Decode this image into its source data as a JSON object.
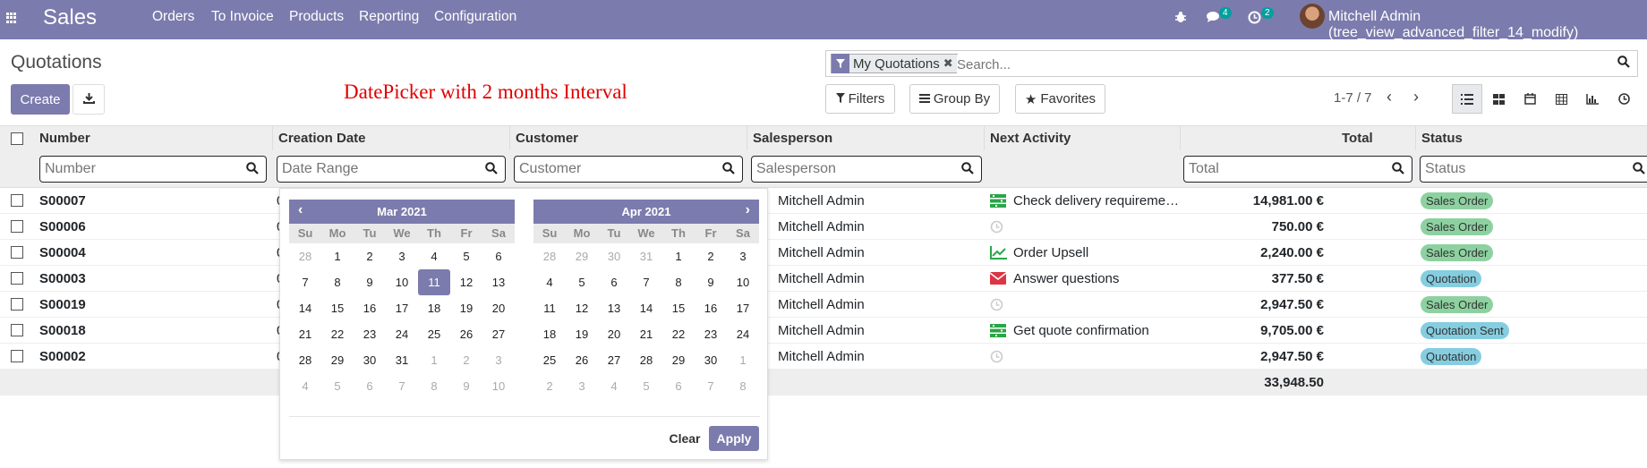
{
  "nav": {
    "app_name": "Sales",
    "menu": [
      "Orders",
      "To Invoice",
      "Products",
      "Reporting",
      "Configuration"
    ],
    "messages_count": "4",
    "activities_count": "2",
    "user_label": "Mitchell Admin (tree_view_advanced_filter_14_modify)"
  },
  "control_panel": {
    "title": "Quotations",
    "create_label": "Create",
    "annotation": "DatePicker with 2 months Interval",
    "facet_label": "My Quotations",
    "search_placeholder": "Search...",
    "filters_label": "Filters",
    "groupby_label": "Group By",
    "favorites_label": "Favorites",
    "pager_text": "1-7 / 7"
  },
  "table": {
    "headers": [
      "Number",
      "Creation Date",
      "Customer",
      "Salesperson",
      "Next Activity",
      "Total",
      "Status"
    ],
    "filter_placeholders": {
      "number": "Number",
      "date": "Date Range",
      "customer": "Customer",
      "salesperson": "Salesperson",
      "total": "Total",
      "status": "Status"
    },
    "rows": [
      {
        "number": "S00007",
        "date": "0",
        "salesperson": "Mitchell Admin",
        "activity": "Check delivery requireme…",
        "activity_icon": "activity-list-icon",
        "total": "14,981.00 €",
        "status": "Sales Order"
      },
      {
        "number": "S00006",
        "date": "0",
        "salesperson": "Mitchell Admin",
        "activity": "",
        "activity_icon": "clock-icon",
        "total": "750.00 €",
        "status": "Sales Order"
      },
      {
        "number": "S00004",
        "date": "0",
        "salesperson": "Mitchell Admin",
        "activity": "Order Upsell",
        "activity_icon": "chart-line-icon",
        "total": "2,240.00 €",
        "status": "Sales Order"
      },
      {
        "number": "S00003",
        "date": "0",
        "salesperson": "Mitchell Admin",
        "activity": "Answer questions",
        "activity_icon": "envelope-icon",
        "total": "377.50 €",
        "status": "Quotation"
      },
      {
        "number": "S00019",
        "date": "0",
        "salesperson": "Mitchell Admin",
        "activity": "",
        "activity_icon": "clock-icon",
        "total": "2,947.50 €",
        "status": "Sales Order"
      },
      {
        "number": "S00018",
        "date": "0",
        "salesperson": "Mitchell Admin",
        "activity": "Get quote confirmation",
        "activity_icon": "activity-list-icon",
        "total": "9,705.00 €",
        "status": "Quotation Sent"
      },
      {
        "number": "S00002",
        "date": "0",
        "salesperson": "Mitchell Admin",
        "activity": "",
        "activity_icon": "clock-icon",
        "total": "2,947.50 €",
        "status": "Quotation"
      }
    ],
    "grand_total": "33,948.50"
  },
  "status_colors": {
    "Sales Order": "#8dd1a0",
    "Quotation": "#85cde0",
    "Quotation Sent": "#85cde0"
  },
  "datepicker": {
    "dows": [
      "Su",
      "Mo",
      "Tu",
      "We",
      "Th",
      "Fr",
      "Sa"
    ],
    "left": {
      "month": "Mar 2021",
      "days": [
        "28",
        "1",
        "2",
        "3",
        "4",
        "5",
        "6",
        "7",
        "8",
        "9",
        "10",
        "11",
        "12",
        "13",
        "14",
        "15",
        "16",
        "17",
        "18",
        "19",
        "20",
        "21",
        "22",
        "23",
        "24",
        "25",
        "26",
        "27",
        "28",
        "29",
        "30",
        "31",
        "1",
        "2",
        "3",
        "4",
        "5",
        "6",
        "7",
        "8",
        "9",
        "10"
      ],
      "muted_first": 1,
      "muted_after": 32,
      "selected": 11
    },
    "right": {
      "month": "Apr 2021",
      "days": [
        "28",
        "29",
        "30",
        "31",
        "1",
        "2",
        "3",
        "4",
        "5",
        "6",
        "7",
        "8",
        "9",
        "10",
        "11",
        "12",
        "13",
        "14",
        "15",
        "16",
        "17",
        "18",
        "19",
        "20",
        "21",
        "22",
        "23",
        "24",
        "25",
        "26",
        "27",
        "28",
        "29",
        "30",
        "1",
        "2",
        "3",
        "4",
        "5",
        "6",
        "7",
        "8"
      ],
      "muted_first": 4,
      "muted_after": 34,
      "selected": -1
    },
    "clear_label": "Clear",
    "apply_label": "Apply"
  },
  "colors": {
    "brand": "#7c7bad",
    "activity_green": "#28a745",
    "activity_red": "#dc3545"
  }
}
